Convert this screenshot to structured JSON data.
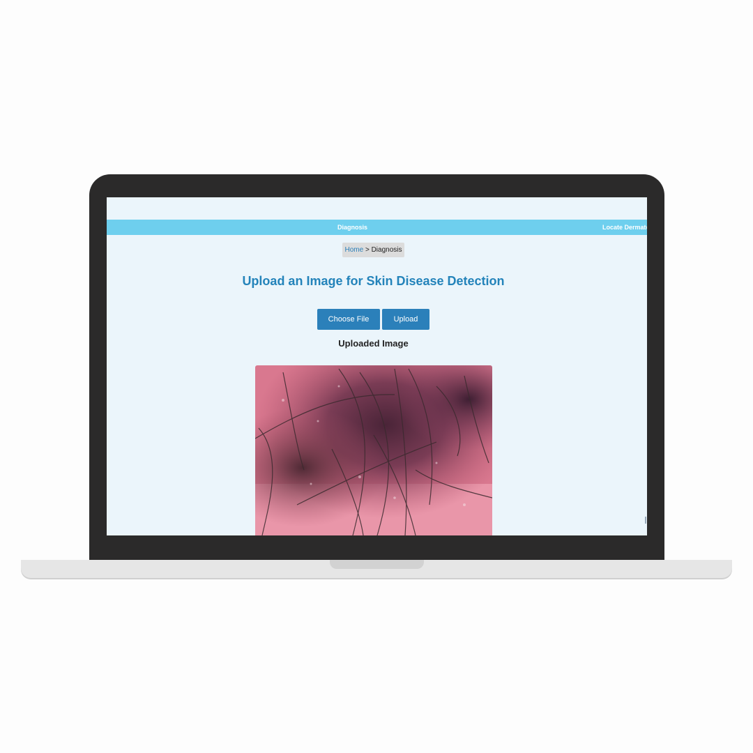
{
  "navbar": {
    "items": [
      {
        "label": "Diagnosis"
      },
      {
        "label": "Locate Dermato"
      }
    ]
  },
  "breadcrumb": {
    "home": "Home",
    "separator": ">",
    "current": "Diagnosis"
  },
  "page": {
    "title": "Upload an Image for Skin Disease Detection",
    "choose_file_label": "Choose File",
    "upload_label": "Upload",
    "uploaded_heading": "Uploaded Image"
  },
  "colors": {
    "navbar": "#6ecfee",
    "page_background": "#ebf5fb",
    "title": "#2383ba",
    "button": "#2b80ba",
    "laptop_bezel": "#2b2a2a"
  },
  "image": {
    "description_icon": "dermoscopy-lesion-image"
  }
}
